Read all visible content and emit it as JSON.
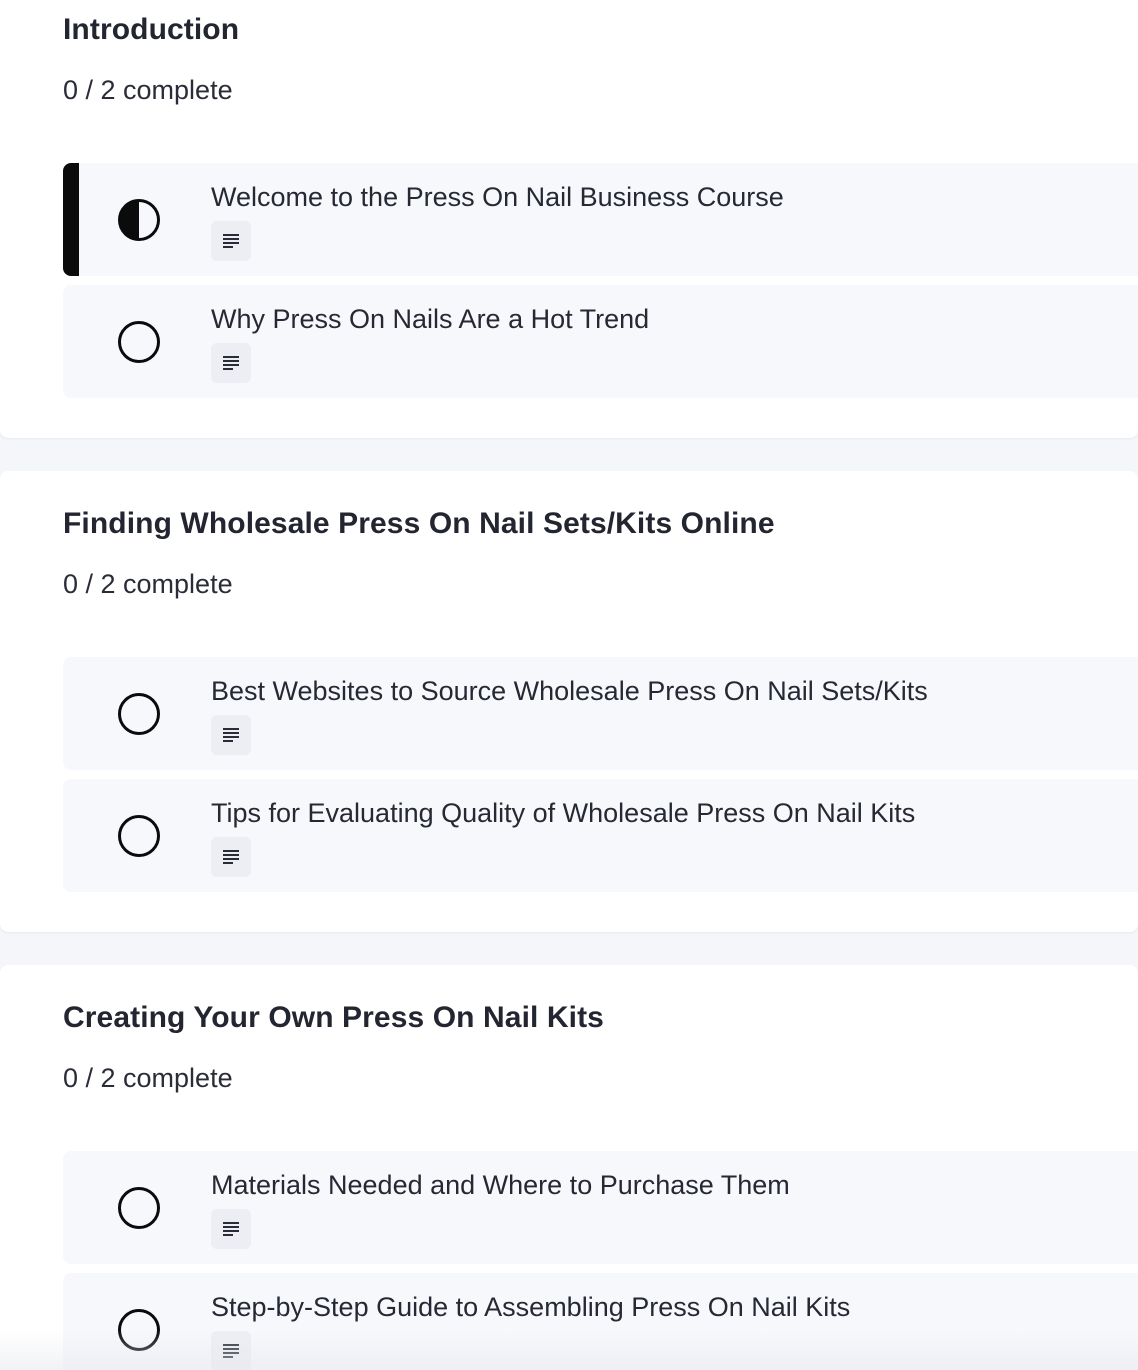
{
  "sections": [
    {
      "title": "Introduction",
      "progress": "0 / 2 complete",
      "lessons": [
        {
          "title": "Welcome to the Press On Nail Business Course",
          "status": "in-progress",
          "type_icon": "text-document-icon"
        },
        {
          "title": "Why Press On Nails Are a Hot Trend",
          "status": "not-started",
          "type_icon": "text-document-icon"
        }
      ]
    },
    {
      "title": "Finding Wholesale Press On Nail Sets/Kits Online",
      "progress": "0 / 2 complete",
      "lessons": [
        {
          "title": "Best Websites to Source Wholesale Press On Nail Sets/Kits",
          "status": "not-started",
          "type_icon": "text-document-icon"
        },
        {
          "title": "Tips for Evaluating Quality of Wholesale Press On Nail Kits",
          "status": "not-started",
          "type_icon": "text-document-icon"
        }
      ]
    },
    {
      "title": "Creating Your Own Press On Nail Kits",
      "progress": "0 / 2 complete",
      "lessons": [
        {
          "title": "Materials Needed and Where to Purchase Them",
          "status": "not-started",
          "type_icon": "text-document-icon"
        },
        {
          "title": "Step-by-Step Guide to Assembling Press On Nail Kits",
          "status": "not-started",
          "type_icon": "text-document-icon"
        }
      ]
    }
  ],
  "colors": {
    "page_background": "#f5f6fa",
    "card_background": "#ffffff",
    "lesson_background": "#f7f8fc",
    "active_indicator": "#0b0b0b",
    "text": "#232631"
  }
}
